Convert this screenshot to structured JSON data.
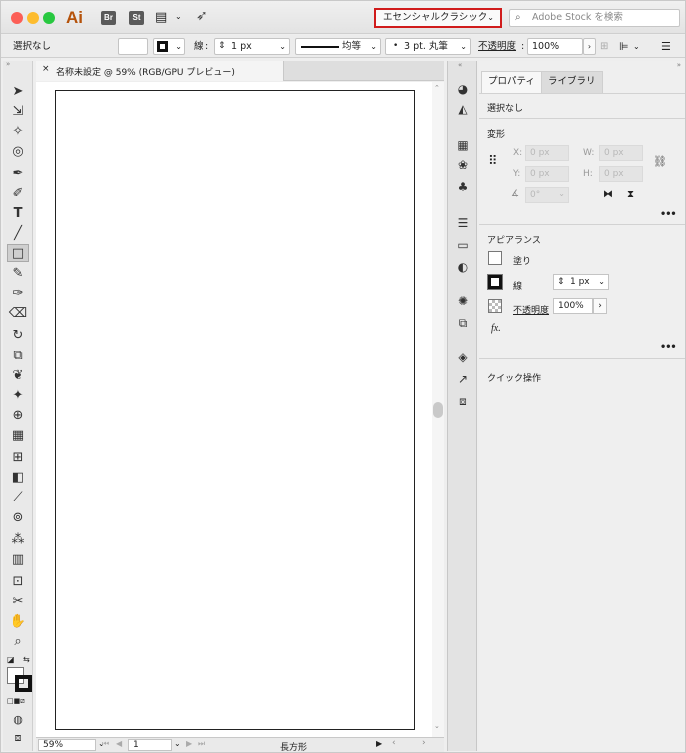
{
  "titlebar": {
    "app_logo": "Ai",
    "bridge_label": "Br",
    "stock_label": "St",
    "workspace": "エセンシャルクラシック",
    "search_placeholder": "Adobe Stock を検索"
  },
  "control_bar": {
    "selection_status": "選択なし",
    "stroke_label": "線",
    "stroke_weight": "1 px",
    "stroke_profile": "均等",
    "brush": "3 pt. 丸筆",
    "opacity_label": "不透明度",
    "opacity_value": "100%"
  },
  "document": {
    "tab_title": "名称未設定 @ 59% (RGB/GPU プレビュー)",
    "zoom": "59%",
    "artboard_number": "1",
    "current_tool": "長方形"
  },
  "properties_panel": {
    "tabs": [
      "プロパティ",
      "ライブラリ"
    ],
    "selection": "選択なし",
    "transform": {
      "title": "変形",
      "x_label": "X:",
      "x_value": "0 px",
      "y_label": "Y:",
      "y_value": "0 px",
      "w_label": "W:",
      "w_value": "0 px",
      "h_label": "H:",
      "h_value": "0 px",
      "angle_value": "0°"
    },
    "appearance": {
      "title": "アピアランス",
      "fill_label": "塗り",
      "stroke_label": "線",
      "stroke_weight": "1 px",
      "opacity_label": "不透明度",
      "opacity_value": "100%",
      "fx_label": "fx."
    },
    "quick_actions": {
      "title": "クイック操作"
    }
  },
  "colors": {
    "ai_orange": "#b5520a",
    "highlight_red": "#d01b1b",
    "traffic_red": "#fc5f57",
    "traffic_yellow": "#fdbc2e",
    "traffic_green": "#28c840"
  }
}
